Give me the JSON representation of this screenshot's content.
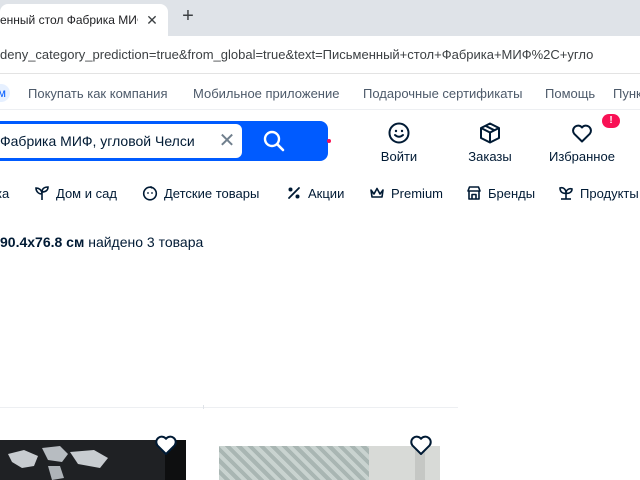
{
  "browser": {
    "tab_title": "енный стол Фабрика МИФ",
    "tab_close": "✕",
    "new_tab": "+",
    "url": "deny_category_prediction=true&from_global=true&text=Письменный+стол+Фабрика+МИФ%2C+угло"
  },
  "toplinks": {
    "pill": "м",
    "items": [
      "Покупать как компания",
      "Мобильное приложение",
      "Подарочные сертификаты",
      "Помощь",
      "Пунк"
    ]
  },
  "search": {
    "value": "Фабрика МИФ, угловой Челси",
    "clear": "✕"
  },
  "header_actions": {
    "login": "Войти",
    "orders": "Заказы",
    "favorites": "Избранное",
    "favorites_badge": "!"
  },
  "categories": [
    "ка",
    "Дом и сад",
    "Детские товары",
    "Акции",
    "Premium",
    "Бренды",
    "Продукты"
  ],
  "result": {
    "bold": "90.4x76.8 см",
    "rest": " найдено 3 товара"
  },
  "colors": {
    "accent": "#005bff",
    "badge": "#f91155",
    "text": "#001a34"
  }
}
